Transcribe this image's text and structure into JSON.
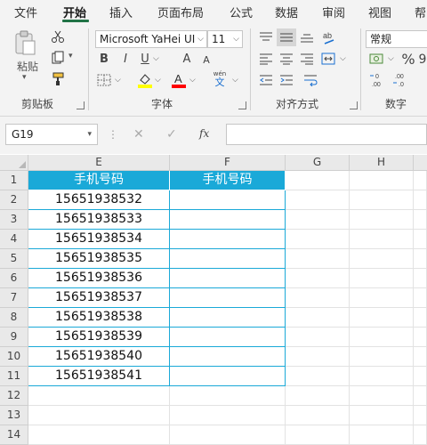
{
  "menu": {
    "items": [
      "文件",
      "开始",
      "插入",
      "页面布局",
      "公式",
      "数据",
      "审阅",
      "视图",
      "帮"
    ],
    "active": "开始"
  },
  "ribbon": {
    "clipboard": {
      "paste_label": "粘贴",
      "group_label": "剪贴板"
    },
    "font": {
      "font_name": "Microsoft YaHei UI",
      "font_size": "11",
      "bold": "B",
      "italic": "I",
      "underline": "U",
      "grow": "A",
      "shrink": "A",
      "phonetic": "wén",
      "phonetic_glyph": "文",
      "group_label": "字体",
      "fill_color": "#ffff00",
      "font_color": "#ff0000"
    },
    "alignment": {
      "group_label": "对齐方式"
    },
    "number": {
      "format": "常规",
      "percent": "%",
      "group_label": "数字"
    }
  },
  "formula_bar": {
    "name_box": "G19",
    "fx": "fx",
    "content": ""
  },
  "sheet": {
    "columns": [
      "E",
      "F",
      "G",
      "H"
    ],
    "rows": [
      "1",
      "2",
      "3",
      "4",
      "5",
      "6",
      "7",
      "8",
      "9",
      "10",
      "11",
      "12",
      "13",
      "14"
    ],
    "header_label_e": "手机号码",
    "header_label_f": "手机号码",
    "phones": [
      "15651938532",
      "15651938533",
      "15651938534",
      "15651938535",
      "15651938536",
      "15651938537",
      "15651938538",
      "15651938539",
      "15651938540",
      "15651938541"
    ],
    "header_fill": "#1aa9d8"
  }
}
